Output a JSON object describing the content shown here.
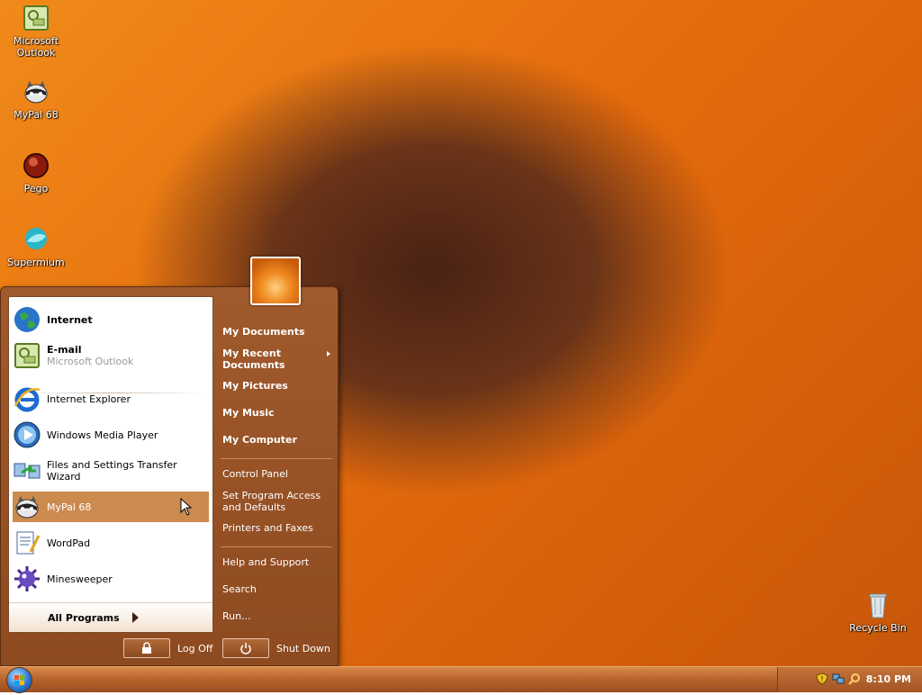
{
  "desktop": {
    "icons": [
      {
        "label": "Microsoft Outlook",
        "icon": "outlook-icon"
      },
      {
        "label": "MyPal 68",
        "icon": "mypal-raccoon-icon"
      },
      {
        "label": "Pego",
        "icon": "pego-icon"
      },
      {
        "label": "Supermium",
        "icon": "supermium-icon"
      },
      {
        "label": "Recycle Bin",
        "icon": "recycle-bin-icon"
      }
    ]
  },
  "start_menu": {
    "pinned": [
      {
        "label": "Internet",
        "sub": "",
        "icon": "globe-icon"
      },
      {
        "label": "E-mail",
        "sub": "Microsoft Outlook",
        "icon": "outlook-icon"
      }
    ],
    "recent": [
      {
        "label": "Internet Explorer",
        "icon": "internet-explorer-icon"
      },
      {
        "label": "Windows Media Player",
        "icon": "media-player-icon"
      },
      {
        "label": "Files and Settings Transfer Wizard",
        "icon": "transfer-wizard-icon"
      },
      {
        "label": "MyPal 68",
        "icon": "mypal-raccoon-icon",
        "selected": true
      },
      {
        "label": "WordPad",
        "icon": "wordpad-icon"
      },
      {
        "label": "Minesweeper",
        "icon": "minesweeper-icon"
      }
    ],
    "all_programs": "All Programs",
    "places": [
      {
        "label": "My Documents"
      },
      {
        "label": "My Recent Documents"
      },
      {
        "label": "My Pictures"
      },
      {
        "label": "My Music"
      },
      {
        "label": "My Computer"
      },
      {
        "label": "Control Panel"
      },
      {
        "label": "Set Program Access and Defaults"
      },
      {
        "label": "Printers and Faxes"
      },
      {
        "label": "Help and Support"
      },
      {
        "label": "Search"
      },
      {
        "label": "Run..."
      }
    ],
    "log_off": "Log Off",
    "shut_down": "Shut Down"
  },
  "taskbar": {
    "clock": "8:10 PM"
  },
  "colors": {
    "menu_bg": "#9a5426",
    "selected_item": "#cd8a4e",
    "taskbar": "#b5622a"
  }
}
